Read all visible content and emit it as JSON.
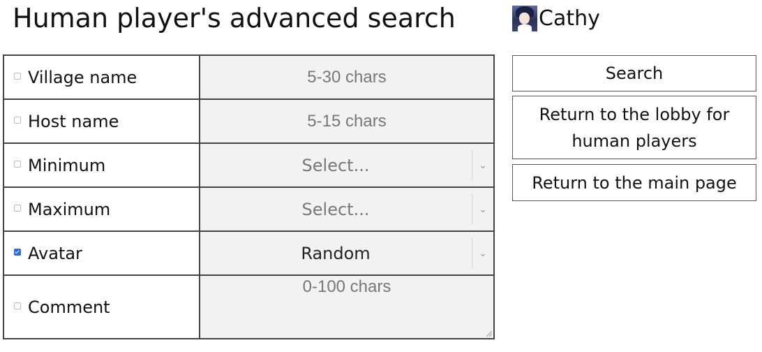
{
  "page": {
    "title": "Human player's advanced search"
  },
  "user": {
    "name": "Cathy",
    "avatar_icon": "character-avatar-icon"
  },
  "form": {
    "rows": [
      {
        "label": "Village name",
        "checked": false,
        "type": "text",
        "placeholder": "5-30 chars"
      },
      {
        "label": "Host name",
        "checked": false,
        "type": "text",
        "placeholder": "5-15 chars"
      },
      {
        "label": "Minimum",
        "checked": false,
        "type": "select",
        "value": "Select..."
      },
      {
        "label": "Maximum",
        "checked": false,
        "type": "select",
        "value": "Select..."
      },
      {
        "label": "Avatar",
        "checked": true,
        "type": "select",
        "value": "Random"
      },
      {
        "label": "Comment",
        "checked": false,
        "type": "textarea",
        "placeholder": "0-100 chars"
      }
    ]
  },
  "buttons": {
    "search": "Search",
    "lobby": "Return to the lobby for human players",
    "main": "Return to the main page"
  },
  "colors": {
    "checkbox_checked": "#2f6ad9",
    "field_bg": "#f2f2f2",
    "border": "#444444"
  }
}
